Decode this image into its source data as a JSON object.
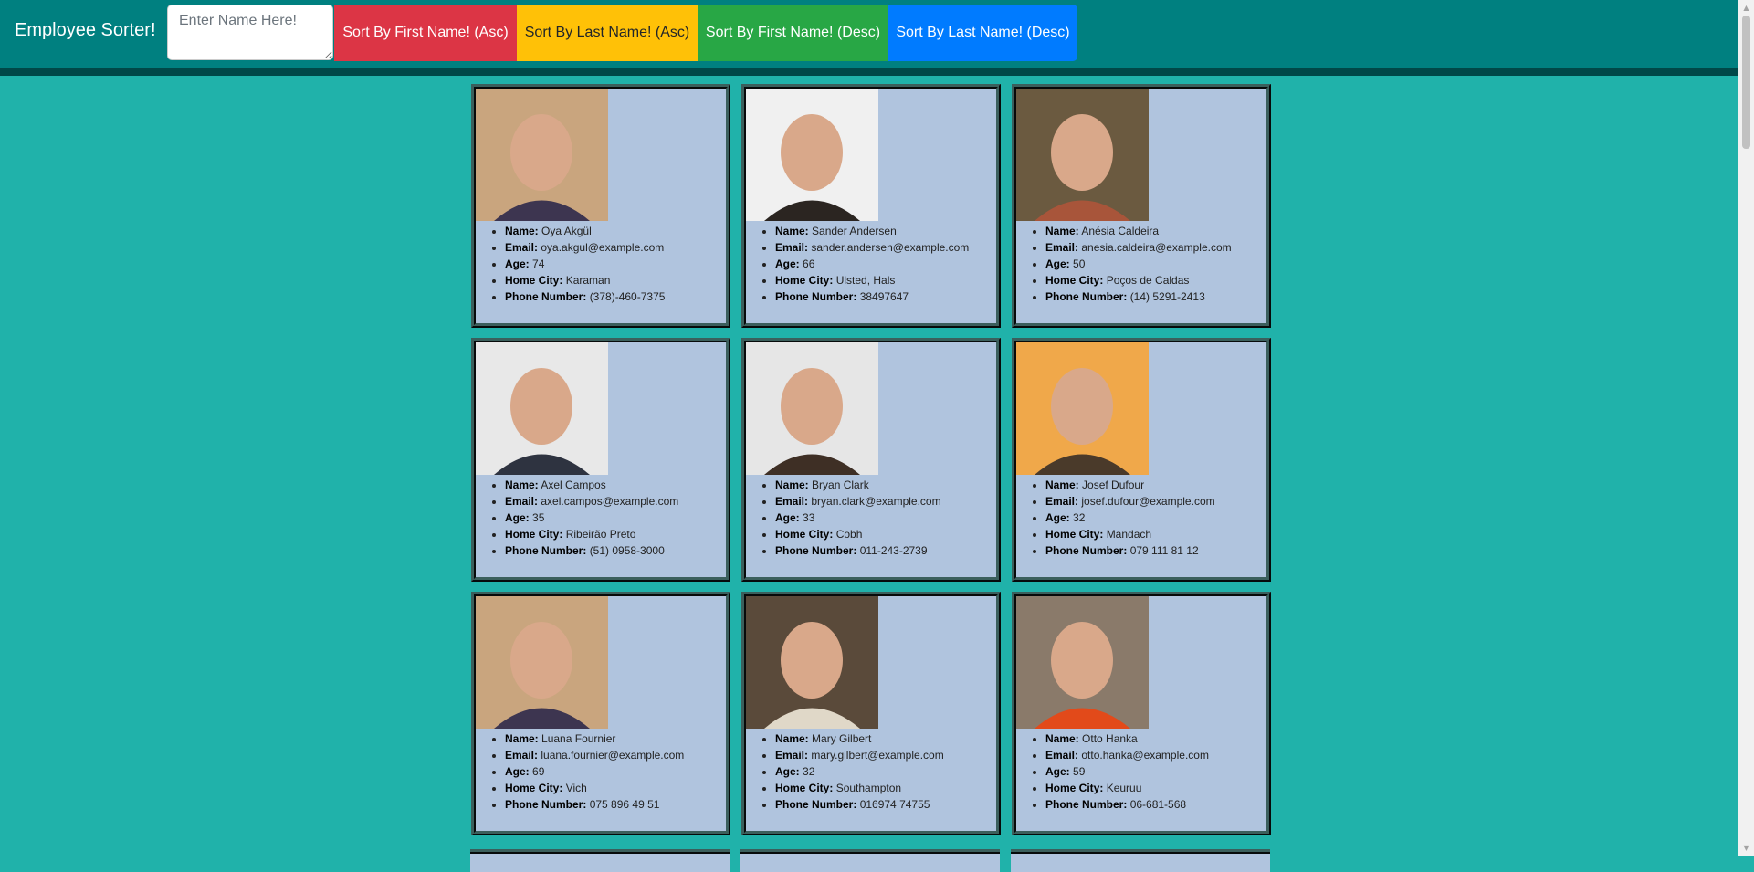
{
  "header": {
    "brand": "Employee Sorter!",
    "search_placeholder": "Enter Name Here!",
    "buttons": [
      "Sort By First Name! (Asc)",
      "Sort By Last Name! (Asc)",
      "Sort By First Name! (Desc)",
      "Sort By Last Name! (Desc)"
    ]
  },
  "labels": {
    "name": "Name:",
    "email": "Email:",
    "age": "Age:",
    "city": "Home City:",
    "phone": "Phone Number:"
  },
  "colors": {
    "page_bg": "#20b2aa",
    "header_bg": "#008080",
    "card_bg": "#b0c4de",
    "btn_first_asc": "#dc3545",
    "btn_last_asc": "#ffc107",
    "btn_first_desc": "#28a745",
    "btn_last_desc": "#007bff"
  },
  "employees": [
    {
      "name": "Oya Akgül",
      "email": "oya.akgul@example.com",
      "age": "74",
      "city": "Karaman",
      "phone": "(378)-460-7375"
    },
    {
      "name": "Sander Andersen",
      "email": "sander.andersen@example.com",
      "age": "66",
      "city": "Ulsted, Hals",
      "phone": "38497647"
    },
    {
      "name": "Anésia Caldeira",
      "email": "anesia.caldeira@example.com",
      "age": "50",
      "city": "Poços de Caldas",
      "phone": "(14) 5291-2413"
    },
    {
      "name": "Axel Campos",
      "email": "axel.campos@example.com",
      "age": "35",
      "city": "Ribeirão Preto",
      "phone": "(51) 0958-3000"
    },
    {
      "name": "Bryan Clark",
      "email": "bryan.clark@example.com",
      "age": "33",
      "city": "Cobh",
      "phone": "011-243-2739"
    },
    {
      "name": "Josef Dufour",
      "email": "josef.dufour@example.com",
      "age": "32",
      "city": "Mandach",
      "phone": "079 111 81 12"
    },
    {
      "name": "Luana Fournier",
      "email": "luana.fournier@example.com",
      "age": "69",
      "city": "Vich",
      "phone": "075 896 49 51"
    },
    {
      "name": "Mary Gilbert",
      "email": "mary.gilbert@example.com",
      "age": "32",
      "city": "Southampton",
      "phone": "016974 74755"
    },
    {
      "name": "Otto Hanka",
      "email": "otto.hanka@example.com",
      "age": "59",
      "city": "Keuruu",
      "phone": "06-681-568"
    }
  ]
}
